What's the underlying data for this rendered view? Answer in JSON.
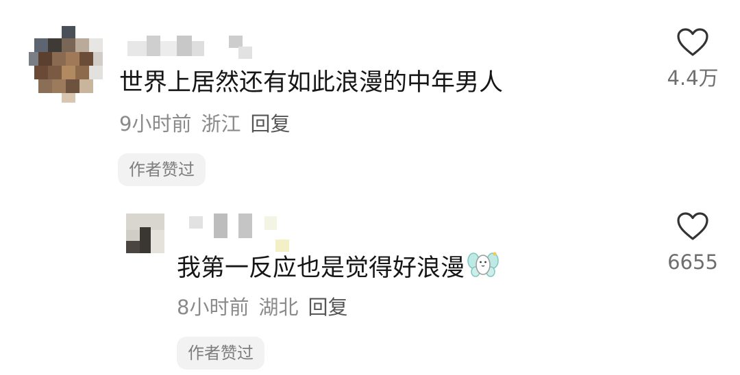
{
  "comments": [
    {
      "text": "世界上居然还有如此浪漫的中年男人",
      "time": "9小时前",
      "location": "浙江",
      "reply_label": "回复",
      "badge": "作者赞过",
      "like_count": "4.4万"
    }
  ],
  "replies": [
    {
      "text": "我第一反应也是觉得好浪漫",
      "emoji_icon": "fairy-emoji-icon",
      "time": "8小时前",
      "location": "湖北",
      "reply_label": "回复",
      "badge": "作者赞过",
      "like_count": "6655"
    }
  ],
  "colors": {
    "text_primary": "#161616",
    "text_meta": "#8a8a8a",
    "badge_bg": "#f2f2f2",
    "icon_stroke": "#333333"
  }
}
